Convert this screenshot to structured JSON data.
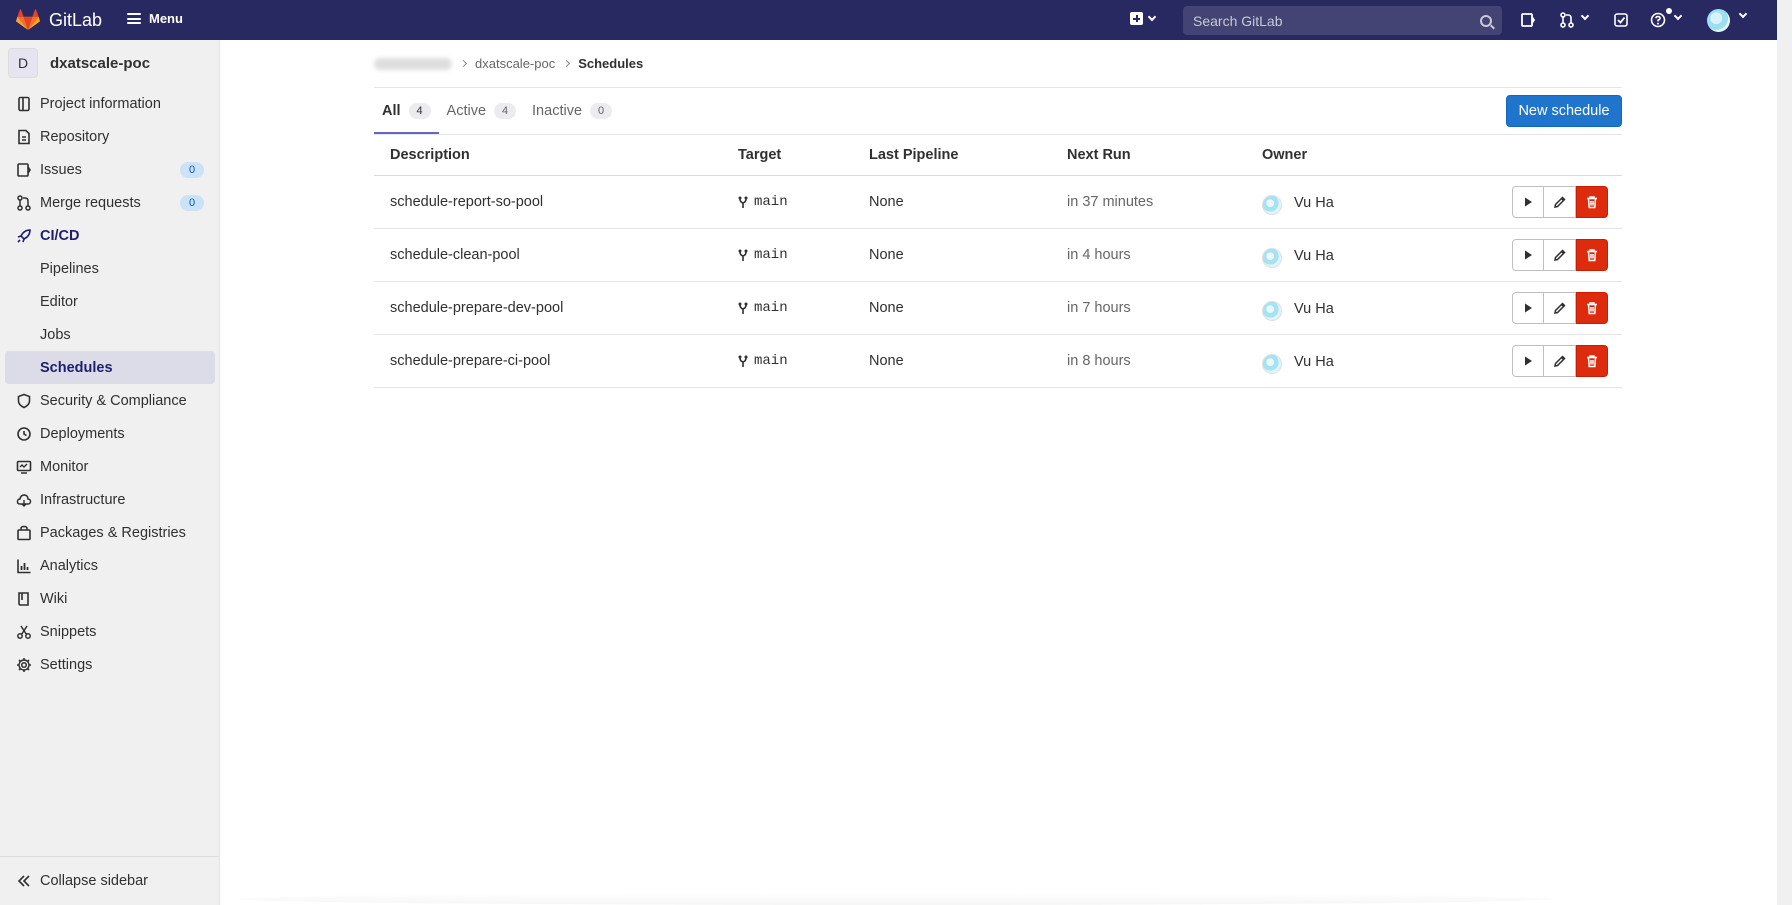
{
  "topbar": {
    "brand": "GitLab",
    "menu_label": "Menu",
    "search_placeholder": "Search GitLab"
  },
  "project": {
    "avatar_letter": "D",
    "name": "dxatscale-poc"
  },
  "sidebar": {
    "items": [
      {
        "label": "Project information",
        "icon": "project-info-icon"
      },
      {
        "label": "Repository",
        "icon": "repository-icon"
      },
      {
        "label": "Issues",
        "icon": "issues-icon",
        "count": "0"
      },
      {
        "label": "Merge requests",
        "icon": "merge-request-icon",
        "count": "0"
      },
      {
        "label": "CI/CD",
        "icon": "rocket-icon"
      },
      {
        "label": "Pipelines"
      },
      {
        "label": "Editor"
      },
      {
        "label": "Jobs"
      },
      {
        "label": "Schedules"
      },
      {
        "label": "Security & Compliance",
        "icon": "shield-icon"
      },
      {
        "label": "Deployments",
        "icon": "deployments-icon"
      },
      {
        "label": "Monitor",
        "icon": "monitor-icon"
      },
      {
        "label": "Infrastructure",
        "icon": "cloud-icon"
      },
      {
        "label": "Packages & Registries",
        "icon": "package-icon"
      },
      {
        "label": "Analytics",
        "icon": "chart-icon"
      },
      {
        "label": "Wiki",
        "icon": "book-icon"
      },
      {
        "label": "Snippets",
        "icon": "scissors-icon"
      },
      {
        "label": "Settings",
        "icon": "gear-icon"
      }
    ],
    "collapse_label": "Collapse sidebar"
  },
  "breadcrumb": {
    "project": "dxatscale-poc",
    "current": "Schedules"
  },
  "tabs": [
    {
      "label": "All",
      "count": "4"
    },
    {
      "label": "Active",
      "count": "4"
    },
    {
      "label": "Inactive",
      "count": "0"
    }
  ],
  "new_schedule_label": "New schedule",
  "table": {
    "headers": {
      "description": "Description",
      "target": "Target",
      "last_pipeline": "Last Pipeline",
      "next_run": "Next Run",
      "owner": "Owner"
    },
    "rows": [
      {
        "description": "schedule-report-so-pool",
        "target": "main",
        "last_pipeline": "None",
        "next_run": "in 37 minutes",
        "owner": "Vu Ha"
      },
      {
        "description": "schedule-clean-pool",
        "target": "main",
        "last_pipeline": "None",
        "next_run": "in 4 hours",
        "owner": "Vu Ha"
      },
      {
        "description": "schedule-prepare-dev-pool",
        "target": "main",
        "last_pipeline": "None",
        "next_run": "in 7 hours",
        "owner": "Vu Ha"
      },
      {
        "description": "schedule-prepare-ci-pool",
        "target": "main",
        "last_pipeline": "None",
        "next_run": "in 8 hours",
        "owner": "Vu Ha"
      }
    ]
  },
  "colors": {
    "topbar": "#292961",
    "primary_button": "#1f75cb",
    "delete_button": "#dd2b0e",
    "active_nav": "#1f1e6f"
  }
}
